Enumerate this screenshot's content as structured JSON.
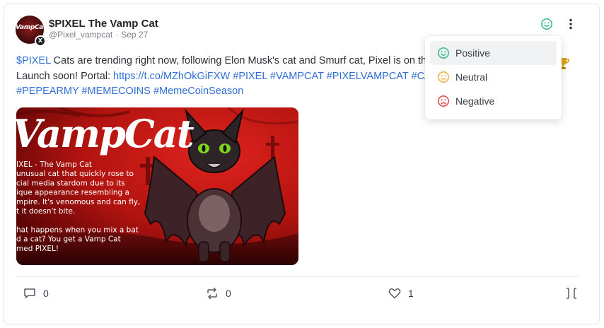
{
  "post": {
    "author_name": "$PIXEL The Vamp Cat",
    "handle": "@Pixel_vampcat",
    "separator": "·",
    "date": "Sep 27",
    "avatar_text": "VampCat",
    "text_lines": [
      [
        {
          "text": "$PIXEL",
          "kind": "link"
        },
        {
          "text": " Cats are trending right now, following Elon Musk's cat and Smurf cat, Pixel is on the",
          "kind": "text"
        }
      ],
      [
        {
          "text": "Launch soon! Portal: ",
          "kind": "text"
        },
        {
          "text": "https://t.co/MZhOkGiFXW",
          "kind": "link"
        },
        {
          "text": " ",
          "kind": "text"
        },
        {
          "text": "#PIXEL",
          "kind": "link"
        },
        {
          "text": " ",
          "kind": "text"
        },
        {
          "text": "#VAMPCAT",
          "kind": "link"
        },
        {
          "text": " ",
          "kind": "text"
        },
        {
          "text": "#PIXELVAMPCAT",
          "kind": "link"
        },
        {
          "text": " ",
          "kind": "text"
        },
        {
          "text": "#CATC",
          "kind": "link"
        }
      ],
      [
        {
          "text": "#PEPEARMY",
          "kind": "link"
        },
        {
          "text": " ",
          "kind": "text"
        },
        {
          "text": "#MEMECOINS",
          "kind": "link"
        },
        {
          "text": " ",
          "kind": "text"
        },
        {
          "text": "#MemeCoinSeason",
          "kind": "link"
        }
      ]
    ],
    "image": {
      "title": "VampCat",
      "caption_lines": [
        "IXEL - The Vamp Cat",
        "unusual cat that quickly rose to",
        "cial media stardom due to its",
        "ique appearance resembling a",
        "mpire. It's venomous and can fly,",
        "t it doesn't bite.",
        "",
        "hat happens when you mix a  bat",
        "d a cat? You get a Vamp Cat",
        "med PIXEL!"
      ]
    },
    "actions": {
      "comments": "0",
      "reposts": "0",
      "likes": "1"
    }
  },
  "sentiment_menu": {
    "options": [
      {
        "label": "Positive",
        "icon": "smile-icon",
        "color": "#3fbf86"
      },
      {
        "label": "Neutral",
        "icon": "neutral-face-icon",
        "color": "#e8b64a"
      },
      {
        "label": "Negative",
        "icon": "frown-icon",
        "color": "#e0504f"
      }
    ],
    "selected": "Positive"
  },
  "colors": {
    "link": "#2f6fd6",
    "positive": "#3fbf86",
    "neutral": "#e8b64a",
    "negative": "#e0504f",
    "trophy": "#d9a21b"
  }
}
